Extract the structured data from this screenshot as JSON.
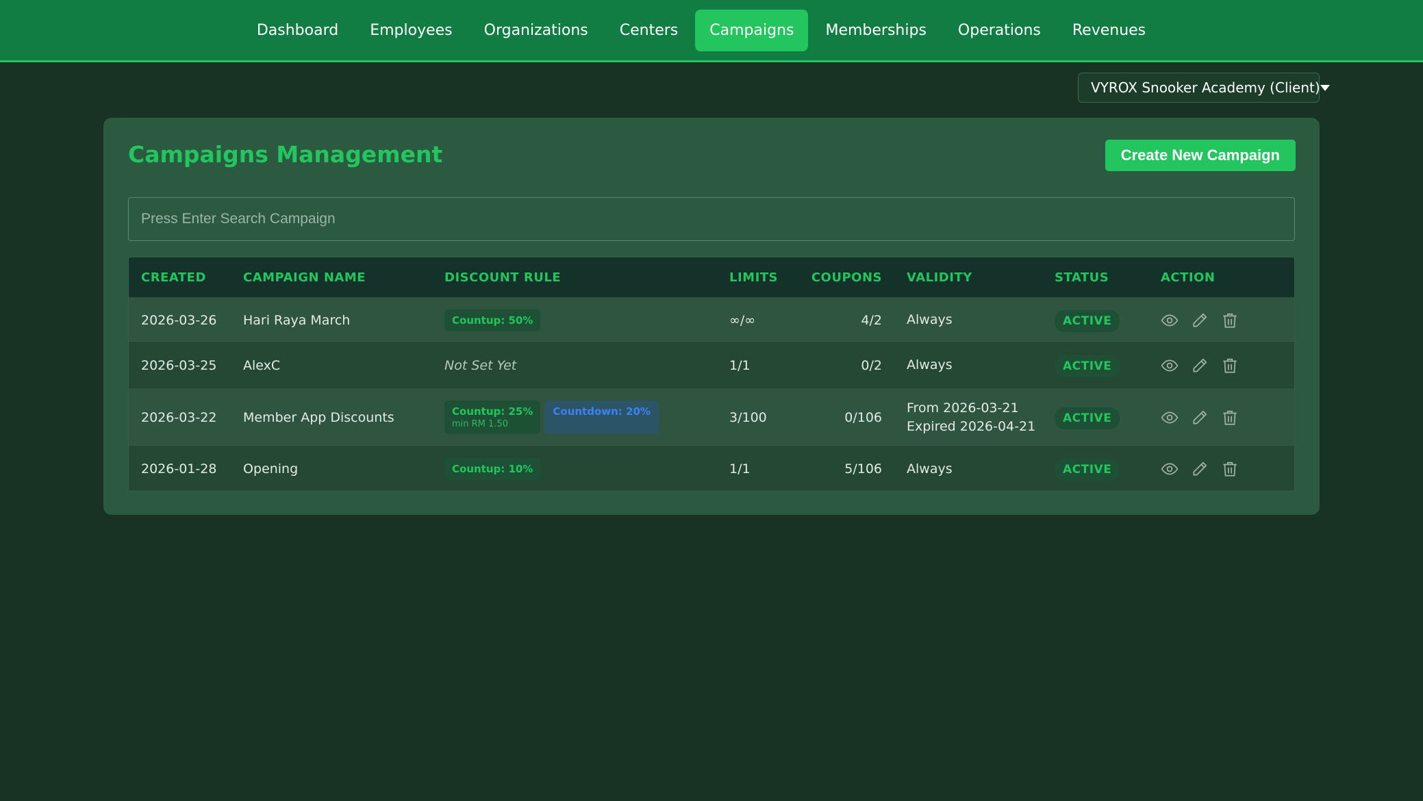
{
  "nav": {
    "items": [
      "Dashboard",
      "Employees",
      "Organizations",
      "Centers",
      "Campaigns",
      "Memberships",
      "Operations",
      "Revenues"
    ],
    "active": "Campaigns"
  },
  "client_select": {
    "value": "VYROX Snooker Academy (Client)"
  },
  "page": {
    "title": "Campaigns Management",
    "create_button": "Create New Campaign",
    "search_placeholder": "Press Enter Search Campaign"
  },
  "table": {
    "headers": {
      "created": "CREATED",
      "name": "CAMPAIGN NAME",
      "rule": "DISCOUNT RULE",
      "limits": "LIMITS",
      "coupons": "COUPONS",
      "validity": "VALIDITY",
      "status": "STATUS",
      "action": "ACTION"
    },
    "rows": [
      {
        "created": "2026-03-26",
        "name": "Hari Raya March",
        "rule_green": "Countup: 50%",
        "limits": "∞/∞",
        "coupons": "4/2",
        "validity_1": "Always",
        "status": "ACTIVE"
      },
      {
        "created": "2026-03-25",
        "name": "AlexC",
        "rule_text": "Not Set Yet",
        "limits": "1/1",
        "coupons": "0/2",
        "validity_1": "Always",
        "status": "ACTIVE"
      },
      {
        "created": "2026-03-22",
        "name": "Member App Discounts",
        "rule_green": "Countup: 25%",
        "rule_green_sub": "min RM 1.50",
        "rule_blue": "Countdown: 20%",
        "limits": "3/100",
        "coupons": "0/106",
        "validity_1": "From 2026-03-21",
        "validity_2": "Expired 2026-04-21",
        "status": "ACTIVE"
      },
      {
        "created": "2026-01-28",
        "name": "Opening",
        "rule_green": "Countup: 10%",
        "limits": "1/1",
        "coupons": "5/106",
        "validity_1": "Always",
        "status": "ACTIVE"
      }
    ]
  },
  "icons": {
    "view": "eye-icon",
    "edit": "pencil-icon",
    "delete": "trash-icon"
  },
  "colors": {
    "accent": "#22c55e",
    "nav_bg": "#117d42",
    "page_bg": "#183323",
    "panel_bg": "#2b5a40",
    "blue": "#3b82f6"
  }
}
